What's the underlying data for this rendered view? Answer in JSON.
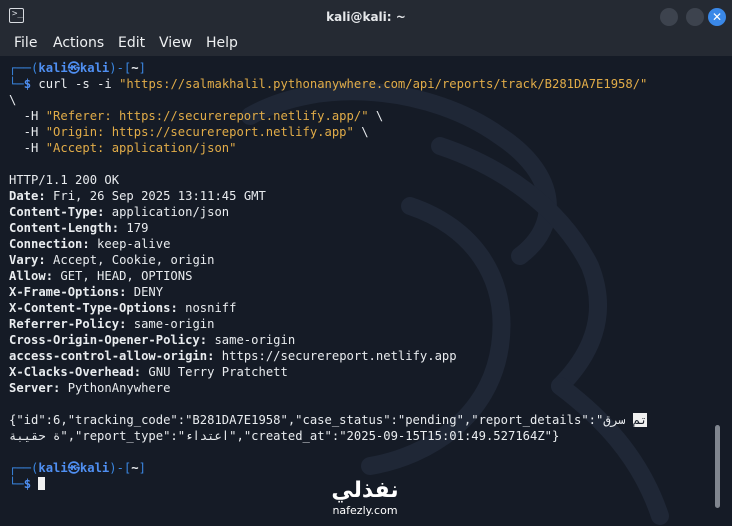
{
  "window": {
    "title": "kali@kali: ~",
    "icon": "terminal-icon",
    "controls": [
      "minimize-icon",
      "maximize-icon",
      "close-icon"
    ],
    "close_symbol": "✕"
  },
  "menu": [
    "File",
    "Actions",
    "Edit",
    "View",
    "Help"
  ],
  "colors": {
    "background": "#151b26",
    "prompt_blue": "#3a86e0",
    "string_orange": "#e1ac48",
    "text": "#e9ecef"
  },
  "prompt": {
    "top_left": "┌──(",
    "user": "kali㉿kali",
    "top_right": ")-[",
    "dir": "~",
    "close": "]",
    "bottom": "└─",
    "symbol": "$"
  },
  "command": {
    "cmd": "curl -s -i ",
    "url": "\"https://salmakhalil.pythonanywhere.com/api/reports/track/B281DA7E1958/\"",
    "continuation": "\\",
    "headers": [
      {
        "flag": "  -H ",
        "value": "\"Referer: https://securereport.netlify.app/\"",
        "tail": " \\"
      },
      {
        "flag": "  -H ",
        "value": "\"Origin: https://securereport.netlify.app\"",
        "tail": " \\"
      },
      {
        "flag": "  -H ",
        "value": "\"Accept: application/json\"",
        "tail": ""
      }
    ]
  },
  "response": {
    "status": "HTTP/1.1 200 OK",
    "headers": [
      {
        "name": "Date",
        "value": " Fri, 26 Sep 2025 13:11:45 GMT"
      },
      {
        "name": "Content-Type",
        "value": " application/json"
      },
      {
        "name": "Content-Length",
        "value": " 179"
      },
      {
        "name": "Connection",
        "value": " keep-alive"
      },
      {
        "name": "Vary",
        "value": " Accept, Cookie, origin"
      },
      {
        "name": "Allow",
        "value": " GET, HEAD, OPTIONS"
      },
      {
        "name": "X-Frame-Options",
        "value": " DENY"
      },
      {
        "name": "X-Content-Type-Options",
        "value": " nosniff"
      },
      {
        "name": "Referrer-Policy",
        "value": " same-origin"
      },
      {
        "name": "Cross-Origin-Opener-Policy",
        "value": " same-origin"
      },
      {
        "name": "access-control-allow-origin",
        "value": " https://securereport.netlify.app"
      },
      {
        "name": "X-Clacks-Overhead",
        "value": " GNU Terry Pratchett"
      },
      {
        "name": "Server",
        "value": " PythonAnywhere"
      }
    ],
    "body_line1_prefix": "{\"id\":6,\"tracking_code\":\"B281DA7E1958\",\"case_status\":\"pending\",\"report_details\":\"",
    "body_line1_highlight": "تم",
    "body_line1_suffix": " سرق",
    "body_line2_prefix": "ة حقيبة",
    "body_line2_mid": "\",\"report_type\":\"",
    "body_line2_type": "اعتداء",
    "body_line2_suffix": "\",\"created_at\":\"2025-09-15T15:01:49.527164Z\"}"
  },
  "watermark": {
    "logo": "نفذلي",
    "url": "nafezly.com"
  }
}
